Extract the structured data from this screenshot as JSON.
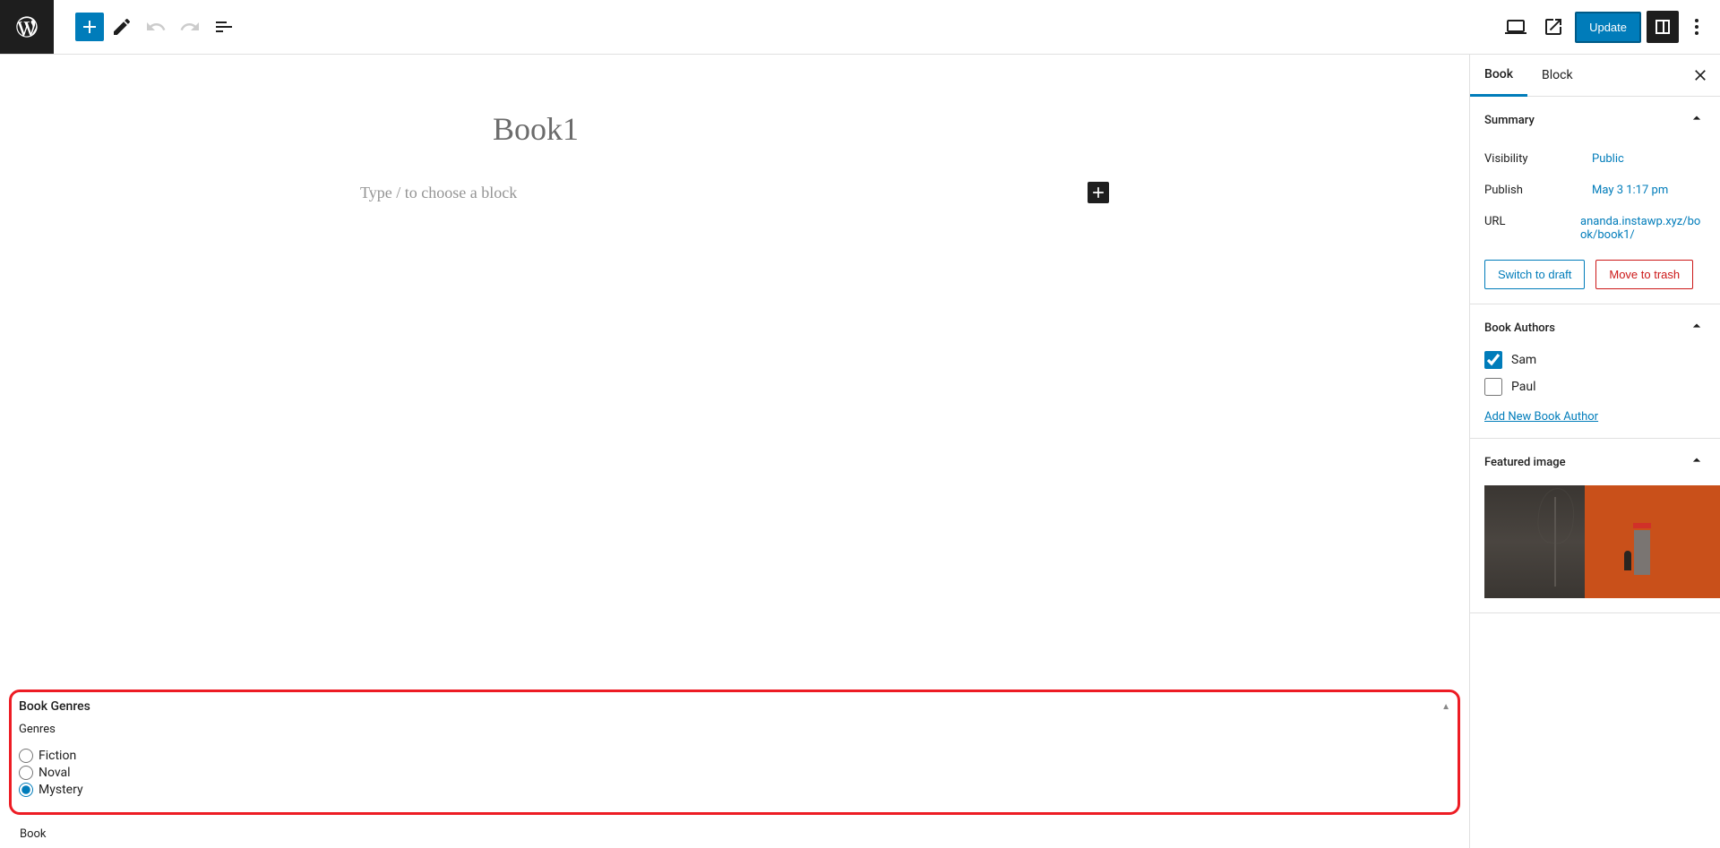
{
  "toolbar": {
    "update_label": "Update"
  },
  "editor": {
    "title": "Book1",
    "placeholder": "Type / to choose a block"
  },
  "metabox": {
    "genres": {
      "title": "Book Genres",
      "label": "Genres",
      "options": [
        {
          "label": "Fiction",
          "checked": false
        },
        {
          "label": "Noval",
          "checked": false
        },
        {
          "label": "Mystery",
          "checked": true
        }
      ]
    }
  },
  "footer": {
    "breadcrumb": "Book"
  },
  "sidebar": {
    "tabs": {
      "book": "Book",
      "block": "Block"
    },
    "summary": {
      "title": "Summary",
      "visibility_label": "Visibility",
      "visibility_value": "Public",
      "publish_label": "Publish",
      "publish_value": "May 3 1:17 pm",
      "url_label": "URL",
      "url_value": "ananda.instawp.xyz/book/book1/",
      "switch_draft": "Switch to draft",
      "move_trash": "Move to trash"
    },
    "authors": {
      "title": "Book Authors",
      "items": [
        {
          "label": "Sam",
          "checked": true
        },
        {
          "label": "Paul",
          "checked": false
        }
      ],
      "add_link": "Add New Book Author"
    },
    "featured": {
      "title": "Featured image"
    }
  }
}
